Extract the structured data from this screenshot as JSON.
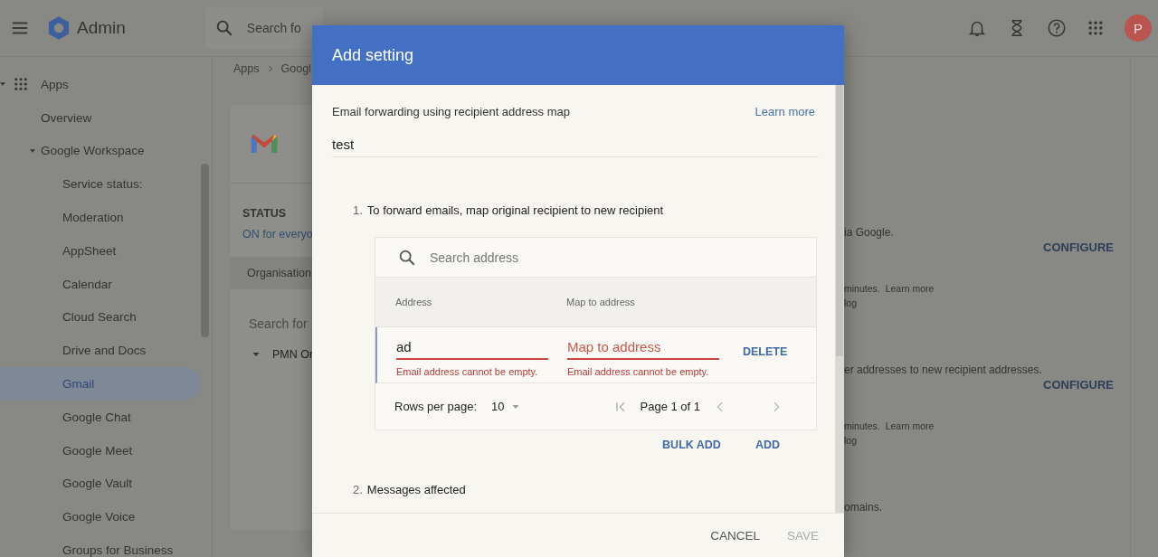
{
  "topbar": {
    "logo_text": "Admin",
    "search": {
      "placeholder": "Search fo"
    },
    "avatar_initial": "P"
  },
  "sidebar": {
    "items": [
      {
        "label": "Apps",
        "expanded": true,
        "selected": false,
        "children": [
          {
            "label": "Overview",
            "selected": false
          },
          {
            "label": "Google Workspace",
            "expanded": true,
            "selected": false,
            "children": [
              {
                "label": "Service status:",
                "selected": false
              },
              {
                "label": "Moderation",
                "selected": false
              },
              {
                "label": "AppSheet",
                "selected": false
              },
              {
                "label": "Calendar",
                "selected": false
              },
              {
                "label": "Cloud Search",
                "selected": false
              },
              {
                "label": "Drive and Docs",
                "selected": false
              },
              {
                "label": "Gmail",
                "selected": true
              },
              {
                "label": "Google Chat",
                "selected": false
              },
              {
                "label": "Google Meet",
                "selected": false
              },
              {
                "label": "Google Vault",
                "selected": false
              },
              {
                "label": "Google Voice",
                "selected": false
              },
              {
                "label": "Groups for Business",
                "selected": false
              }
            ]
          }
        ]
      }
    ]
  },
  "breadcrumb": [
    "Apps",
    "Googl"
  ],
  "app_card": {
    "status_label": "STATUS",
    "status_value": "ON for everyo",
    "tab": "Organisation",
    "search_placeholder": "Search for",
    "org_unit": "PMN Or"
  },
  "settings_peek": [
    {
      "text": "ia Google.",
      "button": "CONFIGURE",
      "note": "minutes.",
      "link": "Learn more",
      "log": "log"
    },
    {
      "text": "er addresses to new recipient addresses.",
      "button": "CONFIGURE",
      "note": "minutes.",
      "link": "Learn more",
      "log": "log"
    },
    {
      "text": "omains."
    }
  ],
  "dialog": {
    "title": "Add setting",
    "setting_name": "Email forwarding using recipient address map",
    "learn_more": "Learn more",
    "description_value": "test",
    "steps": [
      {
        "number": "1.",
        "label": "To forward emails, map original recipient to new recipient"
      },
      {
        "number": "2.",
        "label": "Messages affected"
      }
    ],
    "table": {
      "search_placeholder": "Search address",
      "columns": [
        "Address",
        "Map to address"
      ],
      "rows": [
        {
          "address": {
            "value": "ad",
            "error": true,
            "error_text": "Email address cannot be empty."
          },
          "map_to": {
            "placeholder": "Map to address",
            "error": true,
            "error_text": "Email address cannot be empty."
          },
          "action": "DELETE"
        }
      ],
      "rows_per_page_label": "Rows per page:",
      "rows_per_page": "10",
      "page_text": "Page 1 of 1"
    },
    "table_actions": [
      "BULK ADD",
      "ADD"
    ],
    "footer": [
      {
        "label": "CANCEL",
        "disabled": false
      },
      {
        "label": "SAVE",
        "disabled": true
      }
    ]
  }
}
